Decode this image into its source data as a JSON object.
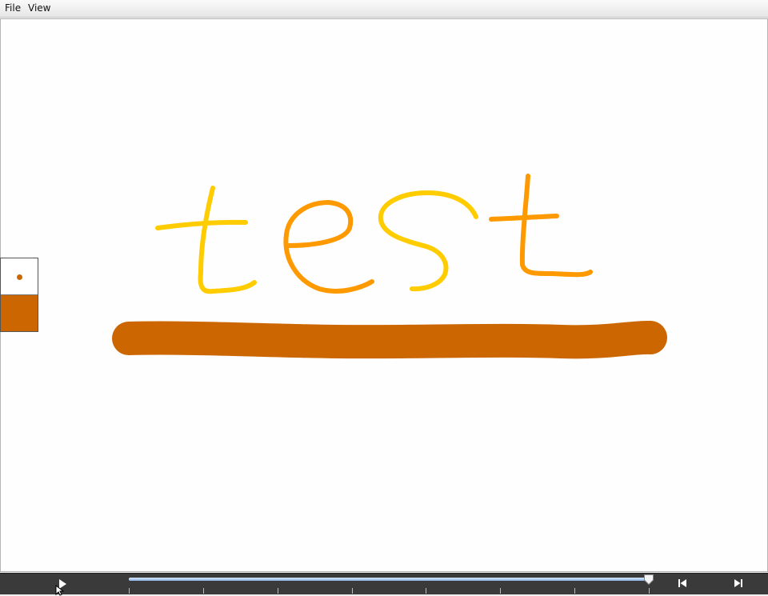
{
  "menubar": {
    "items": [
      {
        "label": "File"
      },
      {
        "label": "View"
      }
    ]
  },
  "canvas": {
    "drawn_text": "test",
    "colors": {
      "yellow": "#FFCC00",
      "orange": "#FF9900",
      "underline": "#CC6600"
    }
  },
  "tool_panel": {
    "brush_color": "#CC6600",
    "swatch_color": "#CC6600"
  },
  "playback": {
    "play_icon": "play-icon",
    "progress": 1.0,
    "tick_count": 8,
    "prev_icon": "skip-back-icon",
    "next_icon": "skip-forward-icon"
  }
}
